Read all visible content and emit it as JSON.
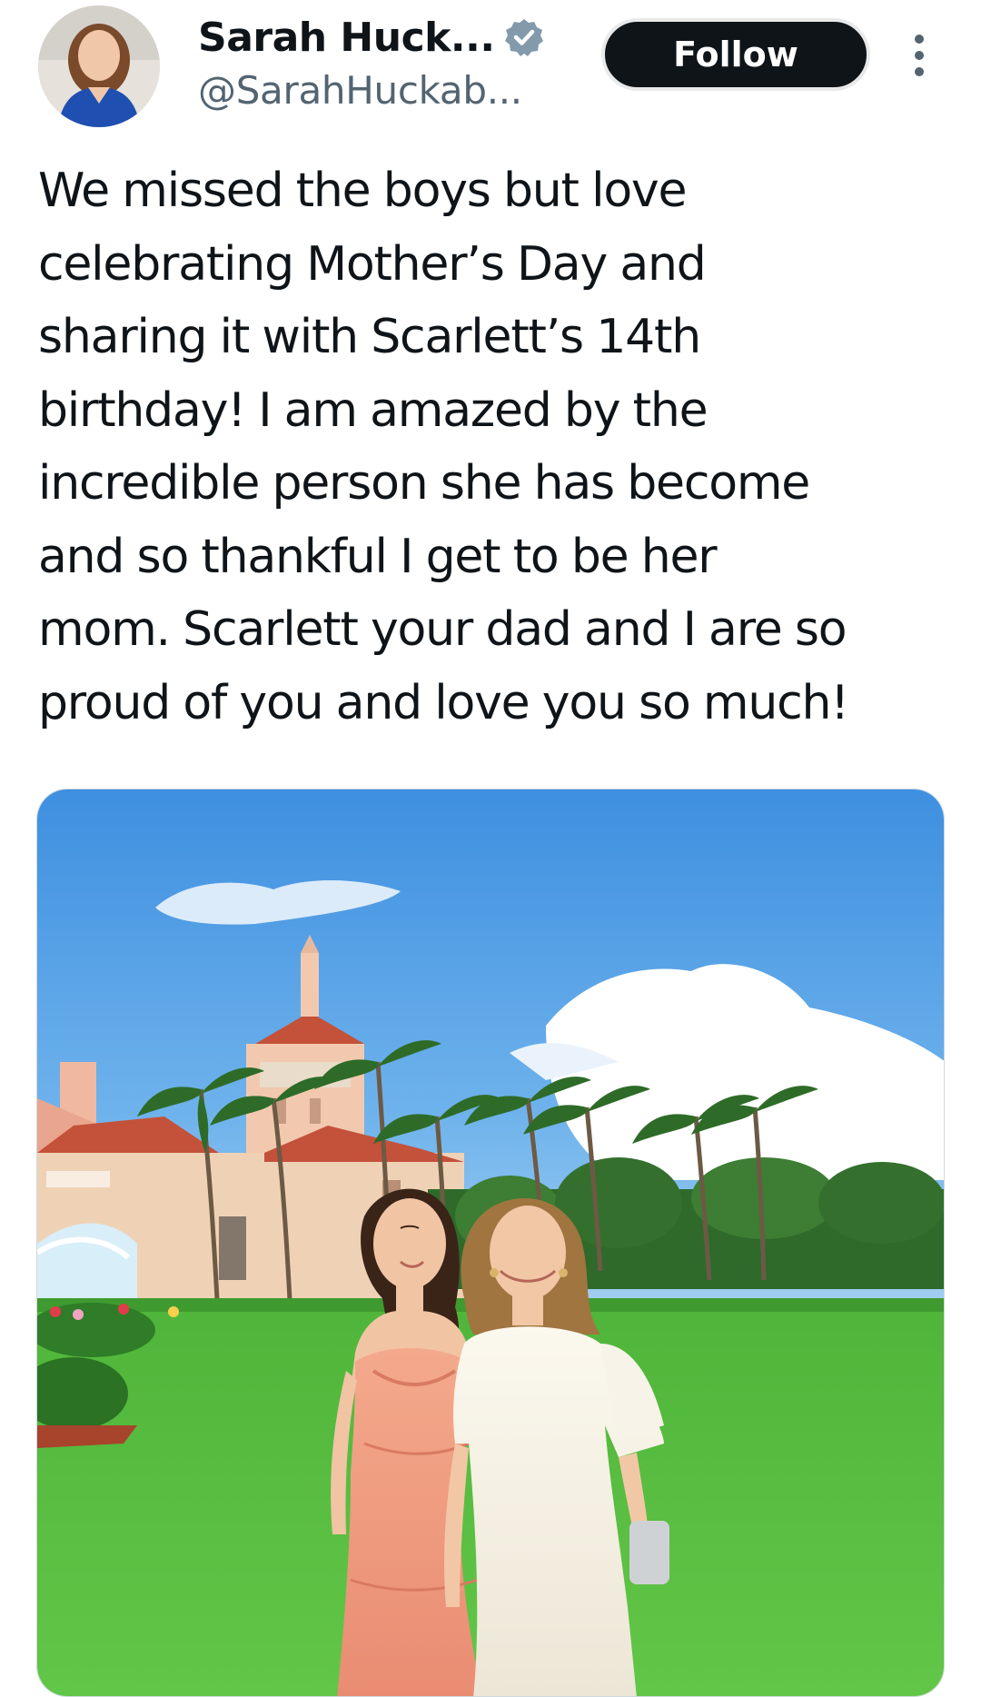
{
  "author": {
    "display_name": "Sarah Huck...",
    "handle": "@SarahHuckab...",
    "verified": true,
    "verified_icon": "verified-badge-icon",
    "avatar_icon": "profile-avatar"
  },
  "actions": {
    "follow_label": "Follow",
    "more_icon": "more-vertical-icon"
  },
  "tweet": {
    "text": "We missed the boys but love\ncelebrating Mother’s Day and\nsharing it with Scarlett’s 14th\nbirthday! I am amazed by the\nincredible person she has become\nand so thankful I get to be her\nmom. Scarlett your dad and I are so\nproud of you and love you so much!"
  },
  "media": {
    "kind": "photo"
  },
  "colors": {
    "text": "#0f1419",
    "secondary_text": "#536471",
    "follow_bg": "#0f1419",
    "verified_badge": "#829aab"
  }
}
